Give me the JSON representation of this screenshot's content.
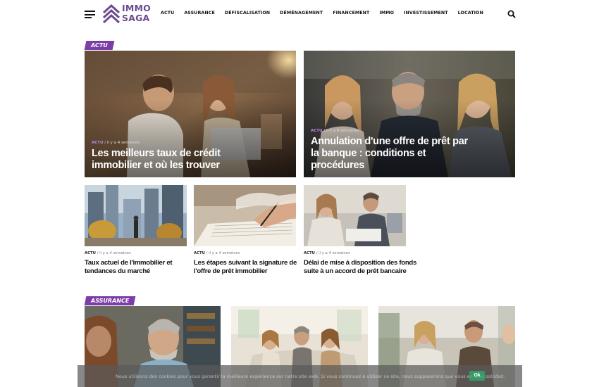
{
  "header": {
    "logo_line1": "IMMO",
    "logo_line2": "SAGA",
    "brand_color": "#6b4b8f",
    "menu_icon": "hamburger-icon",
    "search_icon": "search-icon",
    "nav": [
      "ACTU",
      "ASSURANCE",
      "DÉFISCALISATION",
      "DÉMÉNAGEMENT",
      "FINANCEMENT",
      "IMMO",
      "INVESTISSEMENT",
      "LOCATION"
    ]
  },
  "accent_color": "#7b3ea6",
  "sections": [
    {
      "tag": "ACTU",
      "featured": [
        {
          "category": "ACTU",
          "date": "il y a 4 semaines",
          "title_lines": [
            "Les meilleurs taux de crédit",
            "immobilier et où les trouver"
          ]
        },
        {
          "category": "ACTU",
          "date": "il y a 4 semaines",
          "title_lines": [
            "Annulation d'une offre de prêt par",
            "la banque : conditions et",
            "procédures"
          ]
        }
      ],
      "articles": [
        {
          "category": "ACTU",
          "date": "il y a 4 semaines",
          "title_lines": [
            "Taux actuel de l'immobilier et",
            "tendances du marché"
          ]
        },
        {
          "category": "ACTU",
          "date": "il y a 4 semaines",
          "title_lines": [
            "Les étapes suivant la signature de",
            "l'offre de prêt immobilier"
          ]
        },
        {
          "category": "ACTU",
          "date": "il y a 4 semaines",
          "title_lines": [
            "Délai de mise à disposition des fonds",
            "suite à un accord de prêt bancaire"
          ]
        }
      ]
    },
    {
      "tag": "ASSURANCE"
    }
  ],
  "cookie": {
    "text": "Nous utilisons des cookies pour vous garantir la meilleure expérience sur notre site web. Si vous continuez à utiliser ce site, nous supposerons que vous en êtes satisfait.",
    "ok_label": "Ok"
  }
}
